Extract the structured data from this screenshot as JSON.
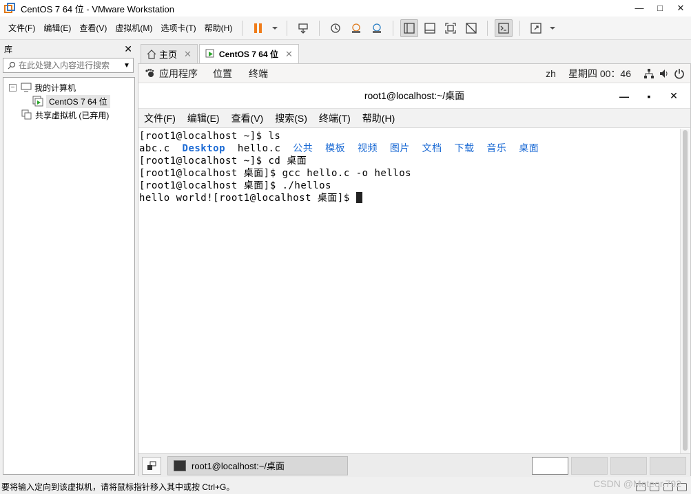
{
  "window": {
    "title": "CentOS 7 64 位 - VMware Workstation",
    "controls": [
      "—",
      "□",
      "✕"
    ]
  },
  "menubar": {
    "items": [
      "文件(F)",
      "编辑(E)",
      "查看(V)",
      "虚拟机(M)",
      "选项卡(T)",
      "帮助(H)"
    ]
  },
  "library": {
    "title": "库",
    "search_placeholder": "在此处键入内容进行搜索",
    "tree": {
      "my_computer": "我的计算机",
      "vm": "CentOS 7 64 位",
      "shared": "共享虚拟机 (已弃用)"
    }
  },
  "tabs": [
    {
      "label": "主页"
    },
    {
      "label": "CentOS 7 64 位"
    }
  ],
  "gnome": {
    "apps": "应用程序",
    "places": "位置",
    "terminal": "终端",
    "lang": "zh",
    "clock": "星期四 00：46"
  },
  "terminal": {
    "title": "root1@localhost:~/桌面",
    "menu": [
      "文件(F)",
      "编辑(E)",
      "查看(V)",
      "搜索(S)",
      "终端(T)",
      "帮助(H)"
    ],
    "lines": {
      "l1": "[root1@localhost ~]$ ls",
      "l2_abc": "abc.c  ",
      "l2_desktop": "Desktop",
      "l2_hello": "  hello.c  ",
      "l2_dirs": "公共  模板  视频  图片  文档  下载  音乐  桌面",
      "l3": "[root1@localhost ~]$ cd 桌面",
      "l4": "[root1@localhost 桌面]$ gcc hello.c -o hellos",
      "l5": "[root1@localhost 桌面]$ ./hellos",
      "l6": "hello world![root1@localhost 桌面]$ "
    }
  },
  "taskbar": {
    "task_label": "root1@localhost:~/桌面"
  },
  "statusbar": {
    "text": "要将输入定向到该虚拟机，请将鼠标指针移入其中或按 Ctrl+G。"
  },
  "watermark": "CSDN @Meteor.792"
}
